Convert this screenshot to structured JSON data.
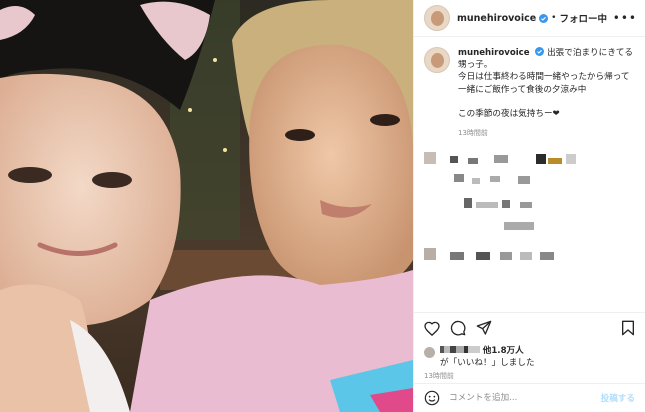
{
  "header": {
    "username": "munehirovoice",
    "separator": "•",
    "follow_status": "フォロー中",
    "more_icon": "more-horizontal-icon"
  },
  "caption": {
    "username": "munehirovoice",
    "lines": [
      "出張で泊まりにきてる甥っ子。",
      "今日は仕事終わる時間一緒やったから帰って一緒にご飯作って食後の夕涼み中",
      "",
      "この季節の夜は気持ちー❤︎"
    ],
    "time_ago": "13時間前"
  },
  "actions": {
    "icons": [
      "heart-icon",
      "comment-icon",
      "share-icon",
      "bookmark-icon"
    ]
  },
  "likes": {
    "count_text": "他1.8万人",
    "line2": "が「いいね！」しました"
  },
  "post_time": "13時間前",
  "comment_box": {
    "placeholder": "コメントを追加...",
    "post_label": "投稿する",
    "emoji_icon": "smiley-icon"
  },
  "colors": {
    "verified_blue": "#3897f0",
    "post_button_disabled": "#b2dffc",
    "muted_text": "#8e8e8e"
  }
}
